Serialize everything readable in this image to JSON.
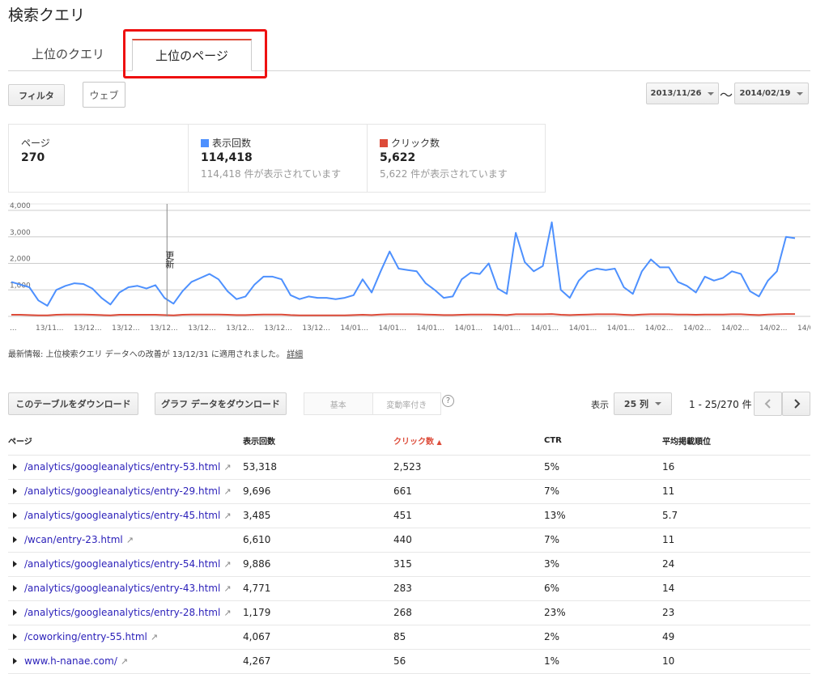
{
  "header": {
    "title": "検索クエリ"
  },
  "tabs": [
    {
      "label": "上位のクエリ"
    },
    {
      "label": "上位のページ"
    }
  ],
  "toolbar": {
    "filter_label": "フィルタ",
    "web_label": "ウェブ",
    "date_start": "2013/11/26",
    "date_sep": "～",
    "date_end": "2014/02/19"
  },
  "stats": {
    "pages": {
      "label": "ページ",
      "value": "270"
    },
    "impressions": {
      "label": "表示回数",
      "value": "114,418",
      "sub": "114,418 件が表示されています"
    },
    "clicks": {
      "label": "クリック数",
      "value": "5,622",
      "sub": "5,622 件が表示されています"
    }
  },
  "colors": {
    "impressions": "#4d90fe",
    "clicks": "#dd4b39",
    "link": "#2a1fb9"
  },
  "chart_data": {
    "type": "line",
    "ylim": [
      0,
      4000
    ],
    "y_ticks": [
      "4,000",
      "3,000",
      "2,000",
      "1,000"
    ],
    "x_tick_labels": [
      "...",
      "13/11...",
      "13/12...",
      "13/12...",
      "13/12...",
      "13/12...",
      "13/12...",
      "13/12...",
      "13/12...",
      "14/01...",
      "14/01...",
      "14/01...",
      "14/01...",
      "14/01...",
      "14/01...",
      "14/01...",
      "14/01...",
      "14/02...",
      "14/02...",
      "14/02...",
      "14/02...",
      "14/0..."
    ],
    "annotation": {
      "label": "更新",
      "index": 18
    },
    "series": [
      {
        "name": "表示回数",
        "color": "#4d90fe",
        "values": [
          1300,
          1200,
          1100,
          600,
          400,
          1000,
          1150,
          1250,
          1220,
          1050,
          700,
          450,
          900,
          1100,
          1150,
          1050,
          1180,
          700,
          480,
          950,
          1300,
          1450,
          1600,
          1400,
          950,
          650,
          750,
          1200,
          1500,
          1500,
          1400,
          800,
          650,
          750,
          700,
          700,
          650,
          700,
          800,
          1400,
          900,
          1700,
          2450,
          1800,
          1750,
          1700,
          1250,
          1000,
          700,
          750,
          1400,
          1650,
          1600,
          2000,
          1050,
          850,
          3150,
          2050,
          1700,
          1900,
          3550,
          1000,
          700,
          1350,
          1700,
          1800,
          1750,
          1800,
          1100,
          850,
          1700,
          2150,
          1850,
          1850,
          1300,
          1150,
          900,
          1500,
          1350,
          1450,
          1700,
          1600,
          950,
          750,
          1350,
          1700,
          3000,
          2950
        ]
      },
      {
        "name": "クリック数",
        "color": "#dd4b39",
        "values": [
          60,
          60,
          50,
          40,
          40,
          60,
          70,
          70,
          70,
          60,
          50,
          40,
          60,
          60,
          60,
          60,
          60,
          50,
          40,
          60,
          70,
          70,
          70,
          70,
          60,
          50,
          50,
          60,
          70,
          70,
          70,
          50,
          40,
          40,
          40,
          40,
          40,
          40,
          50,
          60,
          50,
          70,
          80,
          80,
          80,
          80,
          70,
          60,
          50,
          50,
          60,
          70,
          70,
          70,
          60,
          50,
          80,
          80,
          80,
          80,
          90,
          60,
          50,
          60,
          70,
          80,
          80,
          80,
          60,
          50,
          70,
          80,
          80,
          80,
          70,
          70,
          60,
          70,
          70,
          70,
          80,
          80,
          60,
          50,
          70,
          80,
          90,
          90
        ]
      }
    ]
  },
  "note": {
    "text": "最新情報: 上位検索クエリ データへの改善が 13/12/31 に適用されました。",
    "link": "詳細"
  },
  "table_toolbar": {
    "download_table": "このテーブルをダウンロード",
    "download_graph": "グラフ データをダウンロード",
    "seg_basic": "基本",
    "seg_change": "変動率付き",
    "help": "?",
    "show_label": "表示",
    "rows_select": "25 列",
    "pagination": "1 - 25/270 件"
  },
  "table": {
    "headers": [
      "ページ",
      "表示回数",
      "クリック数",
      "CTR",
      "平均掲載順位"
    ],
    "sort_arrow": "▲",
    "rows": [
      [
        "/analytics/googleanalytics/entry-53.html",
        "53,318",
        "2,523",
        "5%",
        "16"
      ],
      [
        "/analytics/googleanalytics/entry-29.html",
        "9,696",
        "661",
        "7%",
        "11"
      ],
      [
        "/analytics/googleanalytics/entry-45.html",
        "3,485",
        "451",
        "13%",
        "5.7"
      ],
      [
        "/wcan/entry-23.html",
        "6,610",
        "440",
        "7%",
        "11"
      ],
      [
        "/analytics/googleanalytics/entry-54.html",
        "9,886",
        "315",
        "3%",
        "24"
      ],
      [
        "/analytics/googleanalytics/entry-43.html",
        "4,771",
        "283",
        "6%",
        "14"
      ],
      [
        "/analytics/googleanalytics/entry-28.html",
        "1,179",
        "268",
        "23%",
        "23"
      ],
      [
        "/coworking/entry-55.html",
        "4,067",
        "85",
        "2%",
        "49"
      ],
      [
        "www.h-nanae.com/",
        "4,267",
        "56",
        "1%",
        "10"
      ]
    ]
  }
}
